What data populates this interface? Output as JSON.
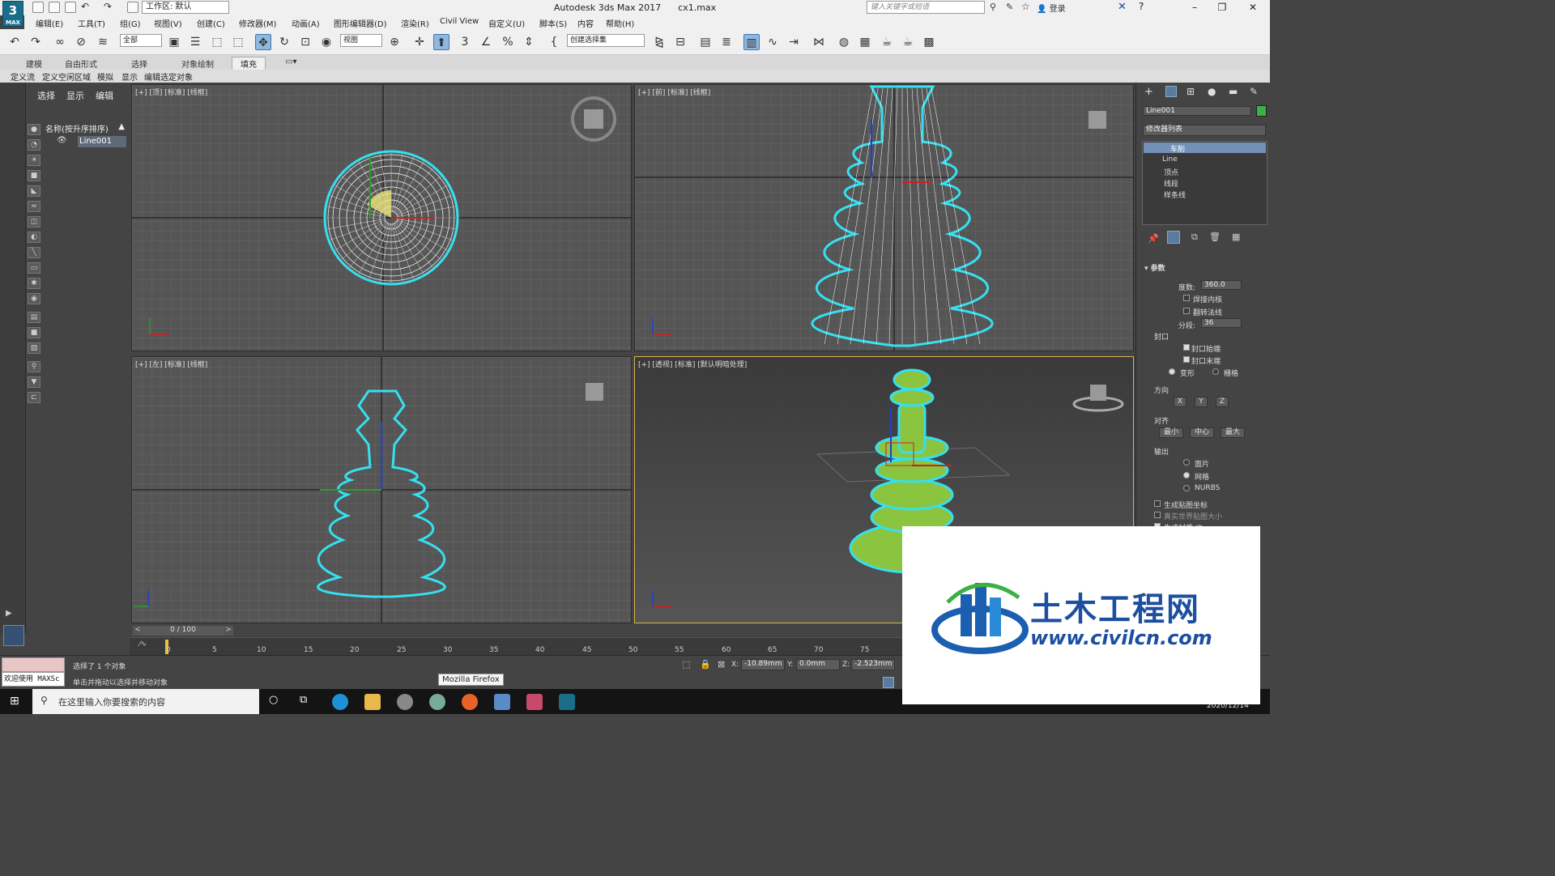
{
  "app": {
    "logo": "3",
    "logo_sub": "MAX",
    "title": "Autodesk 3ds Max 2017",
    "file": "cx1.max"
  },
  "workspace": "工作区: 默认",
  "search": {
    "placeholder": "键入关键字或短语"
  },
  "login": "登录",
  "menus": [
    "编辑(E)",
    "工具(T)",
    "组(G)",
    "视图(V)",
    "创建(C)",
    "修改器(M)",
    "动画(A)",
    "图形编辑器(D)",
    "渲染(R)",
    "Civil View",
    "自定义(U)",
    "脚本(S)",
    "内容",
    "帮助(H)"
  ],
  "toolbar": {
    "filter": "全部",
    "coord": "视图",
    "selset": "创建选择集"
  },
  "ribbon_tabs": [
    "建模",
    "自由形式",
    "选择",
    "对象绘制",
    "填充"
  ],
  "ribbon_tab_active": "填充",
  "ribbon_tools": [
    "定义流",
    "定义空闲区域",
    "模拟",
    "显示",
    "编辑选定对象"
  ],
  "scene_explorer": {
    "tabs": [
      "选择",
      "显示",
      "编辑"
    ],
    "header": "名称(按升序排序)",
    "item": "Line001"
  },
  "viewports": {
    "top": "[+] [顶] [标准] [线框]",
    "front": "[+] [前] [标准] [线框]",
    "left": "[+] [左] [标准] [线框]",
    "persp": "[+] [透视] [标准] [默认明暗处理]"
  },
  "axis_labels": {
    "x": "x",
    "y": "y",
    "z": "z"
  },
  "modify_panel": {
    "object_name": "Line001",
    "object_color": "#3cb043",
    "modifier_list": "修改器列表",
    "stack": [
      "车削",
      "Line",
      "顶点",
      "线段",
      "样条线"
    ],
    "rollout": "参数",
    "degrees_label": "度数:",
    "degrees_value": "360.0",
    "weld_core": "焊接内核",
    "flip_normals": "翻转法线",
    "segments_label": "分段:",
    "segments_value": "36",
    "capping": "封口",
    "cap_start": "封口始端",
    "cap_end": "封口末端",
    "morph": "变形",
    "grid": "栅格",
    "direction": "方向",
    "dir_x": "X",
    "dir_y": "Y",
    "dir_z": "Z",
    "align": "对齐",
    "align_min": "最小",
    "align_center": "中心",
    "align_max": "最大",
    "output": "输出",
    "patch": "面片",
    "mesh": "网格",
    "nurbs": "NURBS",
    "gen_map": "生成贴图坐标",
    "real_world": "真实世界贴图大小",
    "gen_mat": "生成材质 ID"
  },
  "timeline": {
    "frame": "0 / 100",
    "ticks": [
      "0",
      "5",
      "10",
      "15",
      "20",
      "25",
      "30",
      "35",
      "40",
      "45",
      "50",
      "55",
      "60",
      "65",
      "70",
      "75"
    ]
  },
  "status": {
    "maxscript": "欢迎使用 MAXSc",
    "selected": "选择了 1 个对象",
    "prompt": "单击并拖动以选择并移动对象",
    "x_label": "X:",
    "x_value": "-10.89mm",
    "y_label": "Y:",
    "y_value": "0.0mm",
    "z_label": "Z:",
    "z_value": "-2.523mm"
  },
  "tooltip": "Mozilla Firefox",
  "taskbar": {
    "search": "在这里输入你要搜索的内容",
    "date": "2020/12/14"
  },
  "watermark": {
    "cn": "土木工程网",
    "url": "www.civilcn.com"
  },
  "colors": {
    "wire": "#ffffff",
    "select": "#35e0f0",
    "shaded": "#8bc53f"
  }
}
